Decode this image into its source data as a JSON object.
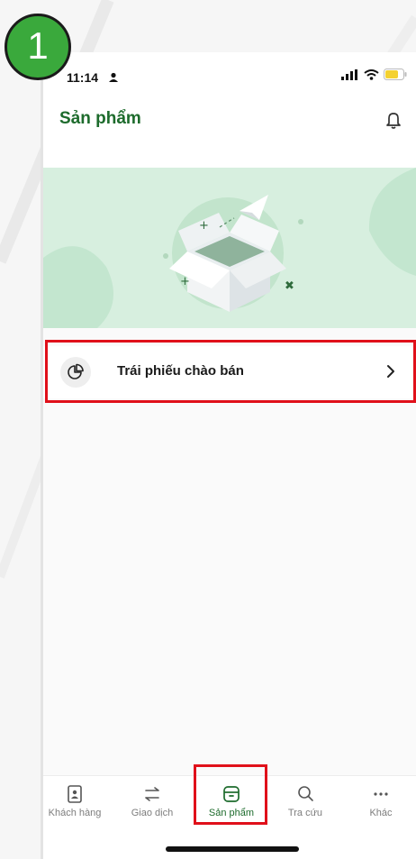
{
  "step": {
    "number": "1"
  },
  "status_bar": {
    "time": "11:14"
  },
  "header": {
    "title": "Sản phẩm"
  },
  "products": [
    {
      "label": "Trái phiếu chào bán"
    }
  ],
  "tabbar": {
    "items": [
      {
        "label": "Khách hàng",
        "icon": "customer-file-icon",
        "active": false
      },
      {
        "label": "Giao dịch",
        "icon": "transfer-arrows-icon",
        "active": false
      },
      {
        "label": "Sản phẩm",
        "icon": "product-box-icon",
        "active": true
      },
      {
        "label": "Tra cứu",
        "icon": "search-icon",
        "active": false
      },
      {
        "label": "Khác",
        "icon": "more-dots-icon",
        "active": false
      }
    ]
  },
  "colors": {
    "brand_green": "#1d6b2c",
    "banner_green": "#d7efdf",
    "badge_green": "#3aa93c",
    "highlight_red": "#e0101a"
  }
}
